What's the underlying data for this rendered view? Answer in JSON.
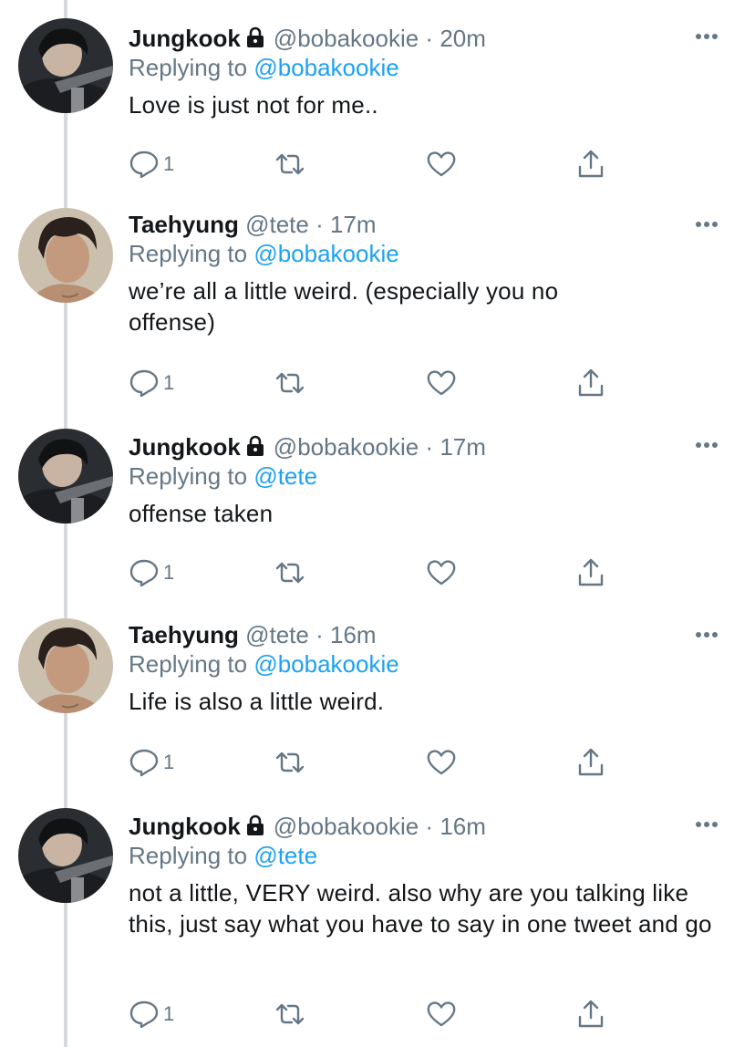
{
  "tweets": [
    {
      "name": "Jungkook",
      "handle": "@bobakookie",
      "dot": "·",
      "time": "20m",
      "replying_prefix": "Replying to",
      "replying_to": "@bobakookie",
      "text": "Love is just not for me..",
      "reply_count": "1",
      "locked": true,
      "avatar": "jungkook"
    },
    {
      "name": "Taehyung",
      "handle": "@tete",
      "dot": "·",
      "time": "17m",
      "replying_prefix": "Replying to",
      "replying_to": "@bobakookie",
      "text": "we’re all a little weird. (especially you no offense)",
      "reply_count": "1",
      "locked": false,
      "avatar": "taehyung"
    },
    {
      "name": "Jungkook",
      "handle": "@bobakookie",
      "dot": "·",
      "time": "17m",
      "replying_prefix": "Replying to",
      "replying_to": "@tete",
      "text": "offense taken",
      "reply_count": "1",
      "locked": true,
      "avatar": "jungkook"
    },
    {
      "name": "Taehyung",
      "handle": "@tete",
      "dot": "·",
      "time": "16m",
      "replying_prefix": "Replying to",
      "replying_to": "@bobakookie",
      "text": "Life is also a little weird.",
      "reply_count": "1",
      "locked": false,
      "avatar": "taehyung"
    },
    {
      "name": "Jungkook",
      "handle": "@bobakookie",
      "dot": "·",
      "time": "16m",
      "replying_prefix": "Replying to",
      "replying_to": "@tete",
      "text": "not a little, VERY weird. also why are you talking like this, just say what you have to say in one tweet and go",
      "reply_count": "1",
      "locked": true,
      "avatar": "jungkook"
    }
  ],
  "icons": {
    "more": "more-icon",
    "lock": "lock-icon",
    "reply": "reply-icon",
    "retweet": "retweet-icon",
    "like": "heart-icon",
    "share": "share-icon"
  },
  "colors": {
    "link": "#1da1f2",
    "secondary": "#657786",
    "primary_text": "#14171a",
    "thread_line": "#d6dadd"
  }
}
